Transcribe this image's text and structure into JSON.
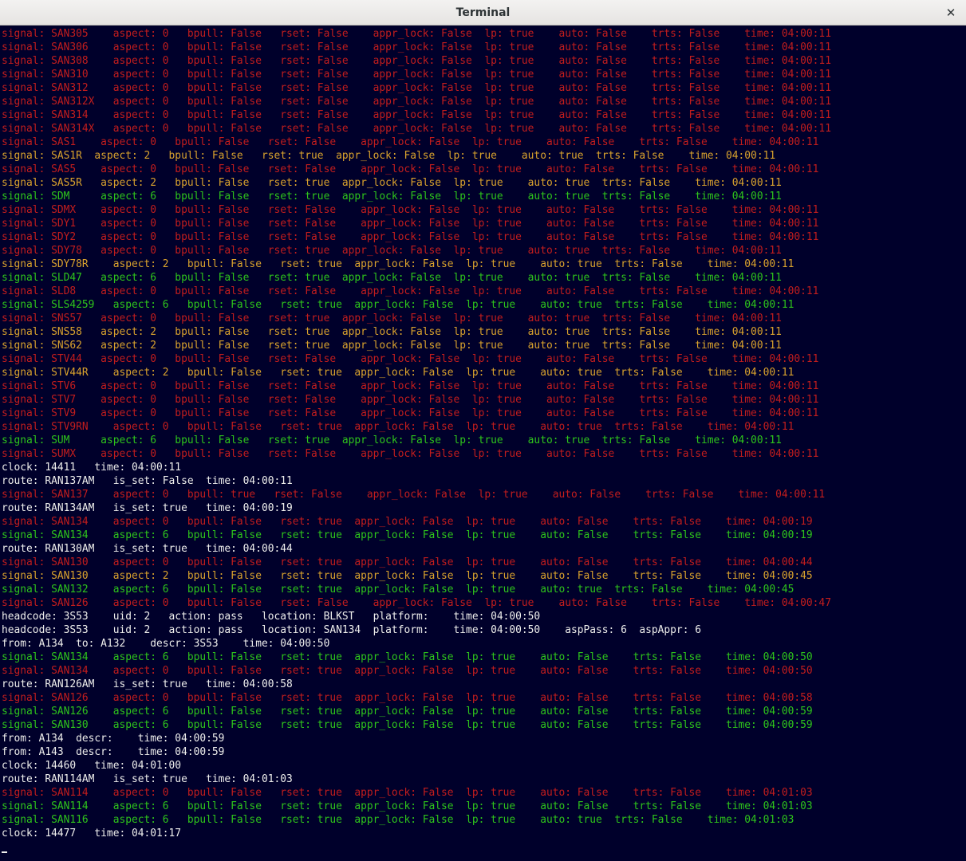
{
  "window": {
    "title": "Terminal",
    "close_icon": "close-icon"
  },
  "colors": {
    "red": "#c21d1d",
    "green": "#2ec41b",
    "amber": "#d9a22d",
    "white": "#eeeeec",
    "background": "#00002b"
  },
  "lines": [
    {
      "c": "red",
      "t": "signal: SAN305    aspect: 0   bpull: False   rset: False    appr_lock: False  lp: true    auto: False    trts: False    time: 04:00:11"
    },
    {
      "c": "red",
      "t": "signal: SAN306    aspect: 0   bpull: False   rset: False    appr_lock: False  lp: true    auto: False    trts: False    time: 04:00:11"
    },
    {
      "c": "red",
      "t": "signal: SAN308    aspect: 0   bpull: False   rset: False    appr_lock: False  lp: true    auto: False    trts: False    time: 04:00:11"
    },
    {
      "c": "red",
      "t": "signal: SAN310    aspect: 0   bpull: False   rset: False    appr_lock: False  lp: true    auto: False    trts: False    time: 04:00:11"
    },
    {
      "c": "red",
      "t": "signal: SAN312    aspect: 0   bpull: False   rset: False    appr_lock: False  lp: true    auto: False    trts: False    time: 04:00:11"
    },
    {
      "c": "red",
      "t": "signal: SAN312X   aspect: 0   bpull: False   rset: False    appr_lock: False  lp: true    auto: False    trts: False    time: 04:00:11"
    },
    {
      "c": "red",
      "t": "signal: SAN314    aspect: 0   bpull: False   rset: False    appr_lock: False  lp: true    auto: False    trts: False    time: 04:00:11"
    },
    {
      "c": "red",
      "t": "signal: SAN314X   aspect: 0   bpull: False   rset: False    appr_lock: False  lp: true    auto: False    trts: False    time: 04:00:11"
    },
    {
      "c": "red",
      "t": "signal: SAS1    aspect: 0   bpull: False   rset: False    appr_lock: False  lp: true    auto: False    trts: False    time: 04:00:11"
    },
    {
      "c": "amber",
      "t": "signal: SAS1R  aspect: 2   bpull: False   rset: true  appr_lock: False  lp: true    auto: true  trts: False    time: 04:00:11"
    },
    {
      "c": "red",
      "t": "signal: SAS5    aspect: 0   bpull: False   rset: False    appr_lock: False  lp: true    auto: False    trts: False    time: 04:00:11"
    },
    {
      "c": "amber",
      "t": "signal: SAS5R   aspect: 2   bpull: False   rset: true  appr_lock: False  lp: true    auto: true  trts: False    time: 04:00:11"
    },
    {
      "c": "green",
      "t": "signal: SDM     aspect: 6   bpull: False   rset: true  appr_lock: False  lp: true    auto: true  trts: False    time: 04:00:11"
    },
    {
      "c": "red",
      "t": "signal: SDMX    aspect: 0   bpull: False   rset: False    appr_lock: False  lp: true    auto: False    trts: False    time: 04:00:11"
    },
    {
      "c": "red",
      "t": "signal: SDY1    aspect: 0   bpull: False   rset: False    appr_lock: False  lp: true    auto: False    trts: False    time: 04:00:11"
    },
    {
      "c": "red",
      "t": "signal: SDY2    aspect: 0   bpull: False   rset: False    appr_lock: False  lp: true    auto: False    trts: False    time: 04:00:11"
    },
    {
      "c": "red",
      "t": "signal: SDY78   aspect: 0   bpull: False   rset: true  appr_lock: False  lp: true    auto: true  trts: False    time: 04:00:11"
    },
    {
      "c": "amber",
      "t": "signal: SDY78R    aspect: 2   bpull: False   rset: true  appr_lock: False  lp: true    auto: true  trts: False    time: 04:00:11"
    },
    {
      "c": "green",
      "t": "signal: SLD47   aspect: 6   bpull: False   rset: true  appr_lock: False  lp: true    auto: true  trts: False    time: 04:00:11"
    },
    {
      "c": "red",
      "t": "signal: SLD8    aspect: 0   bpull: False   rset: False    appr_lock: False  lp: true    auto: False    trts: False    time: 04:00:11"
    },
    {
      "c": "green",
      "t": "signal: SLS4259   aspect: 6   bpull: False   rset: true  appr_lock: False  lp: true    auto: true  trts: False    time: 04:00:11"
    },
    {
      "c": "red",
      "t": "signal: SNS57   aspect: 0   bpull: False   rset: true  appr_lock: False  lp: true    auto: true  trts: False    time: 04:00:11"
    },
    {
      "c": "amber",
      "t": "signal: SNS58   aspect: 2   bpull: False   rset: true  appr_lock: False  lp: true    auto: true  trts: False    time: 04:00:11"
    },
    {
      "c": "amber",
      "t": "signal: SNS62   aspect: 2   bpull: False   rset: true  appr_lock: False  lp: true    auto: true  trts: False    time: 04:00:11"
    },
    {
      "c": "red",
      "t": "signal: STV44   aspect: 0   bpull: False   rset: False    appr_lock: False  lp: true    auto: False    trts: False    time: 04:00:11"
    },
    {
      "c": "amber",
      "t": "signal: STV44R    aspect: 2   bpull: False   rset: true  appr_lock: False  lp: true    auto: true  trts: False    time: 04:00:11"
    },
    {
      "c": "red",
      "t": "signal: STV6    aspect: 0   bpull: False   rset: False    appr_lock: False  lp: true    auto: False    trts: False    time: 04:00:11"
    },
    {
      "c": "red",
      "t": "signal: STV7    aspect: 0   bpull: False   rset: False    appr_lock: False  lp: true    auto: False    trts: False    time: 04:00:11"
    },
    {
      "c": "red",
      "t": "signal: STV9    aspect: 0   bpull: False   rset: False    appr_lock: False  lp: true    auto: False    trts: False    time: 04:00:11"
    },
    {
      "c": "red",
      "t": "signal: STV9RN    aspect: 0   bpull: False   rset: true  appr_lock: False  lp: true    auto: true  trts: False    time: 04:00:11"
    },
    {
      "c": "green",
      "t": "signal: SUM     aspect: 6   bpull: False   rset: true  appr_lock: False  lp: true    auto: true  trts: False    time: 04:00:11"
    },
    {
      "c": "red",
      "t": "signal: SUMX    aspect: 0   bpull: False   rset: False    appr_lock: False  lp: true    auto: False    trts: False    time: 04:00:11"
    },
    {
      "c": "white",
      "t": "clock: 14411   time: 04:00:11"
    },
    {
      "c": "white",
      "t": "route: RAN137AM   is_set: False  time: 04:00:11"
    },
    {
      "c": "red",
      "t": "signal: SAN137    aspect: 0   bpull: true   rset: False    appr_lock: False  lp: true    auto: False    trts: False    time: 04:00:11"
    },
    {
      "c": "white",
      "t": "route: RAN134AM   is_set: true   time: 04:00:19"
    },
    {
      "c": "red",
      "t": "signal: SAN134    aspect: 0   bpull: False   rset: true  appr_lock: False  lp: true    auto: False    trts: False    time: 04:00:19"
    },
    {
      "c": "green",
      "t": "signal: SAN134    aspect: 6   bpull: False   rset: true  appr_lock: False  lp: true    auto: False    trts: False    time: 04:00:19"
    },
    {
      "c": "white",
      "t": "route: RAN130AM   is_set: true   time: 04:00:44"
    },
    {
      "c": "red",
      "t": "signal: SAN130    aspect: 0   bpull: False   rset: true  appr_lock: False  lp: true    auto: False    trts: False    time: 04:00:44"
    },
    {
      "c": "amber",
      "t": "signal: SAN130    aspect: 2   bpull: False   rset: true  appr_lock: False  lp: true    auto: False    trts: False    time: 04:00:45"
    },
    {
      "c": "green",
      "t": "signal: SAN132    aspect: 6   bpull: False   rset: true  appr_lock: False  lp: true    auto: true  trts: False    time: 04:00:45"
    },
    {
      "c": "red",
      "t": "signal: SAN126    aspect: 0   bpull: False   rset: False    appr_lock: False  lp: true    auto: False    trts: False    time: 04:00:47"
    },
    {
      "c": "white",
      "t": "headcode: 3S53    uid: 2   action: pass   location: BLKST   platform:    time: 04:00:50"
    },
    {
      "c": "white",
      "t": "headcode: 3S53    uid: 2   action: pass   location: SAN134  platform:    time: 04:00:50    aspPass: 6  aspAppr: 6"
    },
    {
      "c": "white",
      "t": "from: A134  to: A132    descr: 3S53    time: 04:00:50"
    },
    {
      "c": "green",
      "t": "signal: SAN134    aspect: 6   bpull: False   rset: true  appr_lock: False  lp: true    auto: False    trts: False    time: 04:00:50"
    },
    {
      "c": "red",
      "t": "signal: SAN134    aspect: 0   bpull: False   rset: true  appr_lock: False  lp: true    auto: False    trts: False    time: 04:00:50"
    },
    {
      "c": "white",
      "t": "route: RAN126AM   is_set: true   time: 04:00:58"
    },
    {
      "c": "red",
      "t": "signal: SAN126    aspect: 0   bpull: False   rset: true  appr_lock: False  lp: true    auto: False    trts: False    time: 04:00:58"
    },
    {
      "c": "green",
      "t": "signal: SAN126    aspect: 6   bpull: False   rset: true  appr_lock: False  lp: true    auto: False    trts: False    time: 04:00:59"
    },
    {
      "c": "green",
      "t": "signal: SAN130    aspect: 6   bpull: False   rset: true  appr_lock: False  lp: true    auto: False    trts: False    time: 04:00:59"
    },
    {
      "c": "white",
      "t": "from: A134  descr:    time: 04:00:59"
    },
    {
      "c": "white",
      "t": "from: A143  descr:    time: 04:00:59"
    },
    {
      "c": "white",
      "t": "clock: 14460   time: 04:01:00"
    },
    {
      "c": "white",
      "t": "route: RAN114AM   is_set: true   time: 04:01:03"
    },
    {
      "c": "red",
      "t": "signal: SAN114    aspect: 0   bpull: False   rset: true  appr_lock: False  lp: true    auto: False    trts: False    time: 04:01:03"
    },
    {
      "c": "green",
      "t": "signal: SAN114    aspect: 6   bpull: False   rset: true  appr_lock: False  lp: true    auto: False    trts: False    time: 04:01:03"
    },
    {
      "c": "green",
      "t": "signal: SAN116    aspect: 6   bpull: False   rset: true  appr_lock: False  lp: true    auto: true  trts: False    time: 04:01:03"
    },
    {
      "c": "white",
      "t": "clock: 14477   time: 04:01:17"
    }
  ]
}
